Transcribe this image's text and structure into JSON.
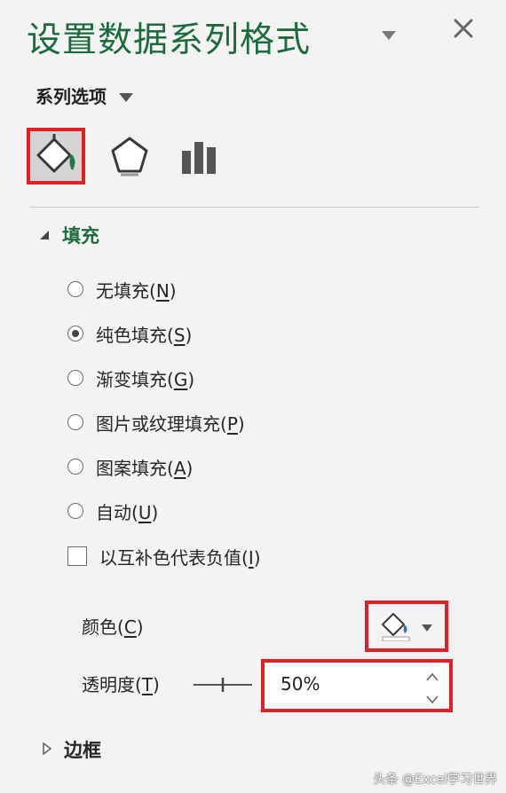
{
  "pane": {
    "title": "设置数据系列格式"
  },
  "series_options": {
    "label": "系列选项"
  },
  "tabs": [
    {
      "name": "填充与线条",
      "selected": true,
      "icon": "paint-bucket-icon"
    },
    {
      "name": "效果",
      "selected": false,
      "icon": "pentagon-icon"
    },
    {
      "name": "系列选项",
      "selected": false,
      "icon": "bar-chart-icon"
    }
  ],
  "fill": {
    "header": "填充",
    "options": [
      {
        "text": "无填充(",
        "key": "N",
        "close": ")",
        "selected": false
      },
      {
        "text": "纯色填充(",
        "key": "S",
        "close": ")",
        "selected": true
      },
      {
        "text": "渐变填充(",
        "key": "G",
        "close": ")",
        "selected": false
      },
      {
        "text": "图片或纹理填充(",
        "key": "P",
        "close": ")",
        "selected": false
      },
      {
        "text": "图案填充(",
        "key": "A",
        "close": ")",
        "selected": false
      },
      {
        "text": "自动(",
        "key": "U",
        "close": ")",
        "selected": false
      }
    ],
    "invert": {
      "text": "以互补色代表负值(",
      "key": "I",
      "close": ")",
      "checked": false
    },
    "color": {
      "text": "颜色(",
      "key": "C",
      "close": ")",
      "swatch": "#ffffff"
    },
    "transparency": {
      "text": "透明度(",
      "key": "T",
      "close": ")",
      "value": "50%",
      "fraction": 0.5
    }
  },
  "border": {
    "header": "边框"
  },
  "watermark": "头条 @Excel学习世界",
  "colors": {
    "accent_green": "#1e6b3f",
    "highlight_red": "#e21e26",
    "panel_bg": "#f3f3f3"
  }
}
